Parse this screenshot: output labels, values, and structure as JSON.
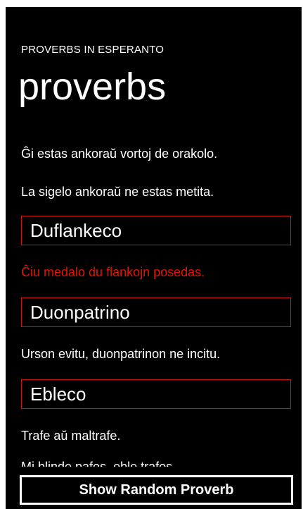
{
  "app_title": "PROVERBS IN ESPERANTO",
  "page_title": "proverbs",
  "proverbs": [
    {
      "text": "Ĝi estas ankoraŭ vortoj de orakolo."
    },
    {
      "text": "La sigelo ankoraŭ ne estas metita."
    },
    {
      "term": "Duflankeco"
    },
    {
      "text": "Ĉiu medalo du flankojn posedas.",
      "highlight": true
    },
    {
      "term": "Duonpatrino"
    },
    {
      "text": "Urson evitu, duonpatrinon ne incitu."
    },
    {
      "term": "Ebleco"
    },
    {
      "text": "Trafe aŭ maltrafe."
    },
    {
      "text": "Mi blinde pafos, eble trafos."
    }
  ],
  "button_label": "Show Random Proverb",
  "colors": {
    "background": "#000000",
    "accent": "#e51400",
    "text": "#ffffff"
  }
}
